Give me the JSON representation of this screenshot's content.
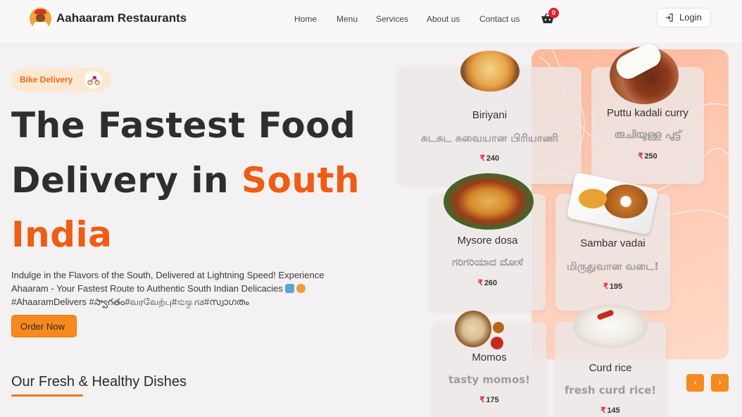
{
  "header": {
    "brand": "Aahaaram Restaurants",
    "nav": [
      "Home",
      "Menu",
      "Services",
      "About us",
      "Contact us"
    ],
    "cart_count": "0",
    "login_label": "Login"
  },
  "hero": {
    "pill_label": "Bike Delivery",
    "headline_line1": "The Fastest Food",
    "headline_line2a": "Delivery in ",
    "headline_line2b": "South",
    "headline_line3": "India",
    "description_line1": "Indulge in the Flavors of the South, Delivered at Lightning Speed! Experience",
    "description_line2": "Ahaaram - Your Fastest Route to Authentic South Indian Delicacies",
    "description_line3": "#AhaaramDelivers #స్వాగతం#வரவேற்பு#ಸುಸ್ವಾಗತ#സ്വാഗതം",
    "order_button": "Order Now"
  },
  "section": {
    "title": "Our Fresh & Healthy Dishes"
  },
  "currency_symbol": "₹",
  "dishes": [
    {
      "name": "Biriyani",
      "local": "சுடசுட சுவையான பிரியாணி",
      "price": "240"
    },
    {
      "name": "Puttu kadali curry",
      "local": "രുചിയുള്ള പുട്ട്",
      "price": "250"
    },
    {
      "name": "Mysore dosa",
      "local": "ಗರಿಗರಿಯಾದ ದೋಸೆ",
      "price": "260"
    },
    {
      "name": "Sambar vadai",
      "local": "மிருதுவான வடை!",
      "price": "195"
    },
    {
      "name": "Momos",
      "local": "tasty momos!",
      "price": "175"
    },
    {
      "name": "Curd rice",
      "local": "fresh curd rice!",
      "price": "145"
    }
  ],
  "carousel": {
    "prev": "‹",
    "next": "›"
  },
  "colors": {
    "accent": "#f7891f",
    "headline_orange": "#ef5c14",
    "badge_red": "#e5202a"
  }
}
